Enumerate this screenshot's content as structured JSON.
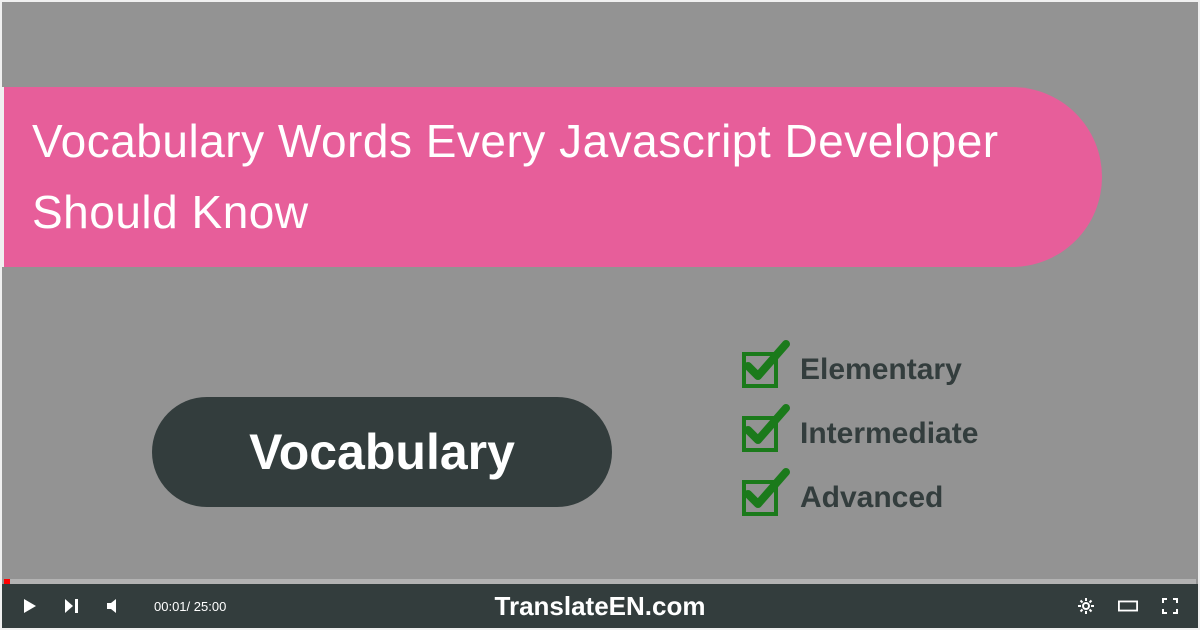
{
  "title": "Vocabulary Words Every Javascript Developer Should Know",
  "pill_label": "Vocabulary",
  "levels": [
    {
      "label": "Elementary"
    },
    {
      "label": "Intermediate"
    },
    {
      "label": "Advanced"
    }
  ],
  "player": {
    "current_time": "00:01",
    "total_time": "25:00",
    "separator": "/ ",
    "site_name": "TranslateEN.com"
  },
  "colors": {
    "banner": "#e75e9a",
    "pill": "#333d3d",
    "check": "#1b7a1b",
    "bg": "#939393"
  }
}
